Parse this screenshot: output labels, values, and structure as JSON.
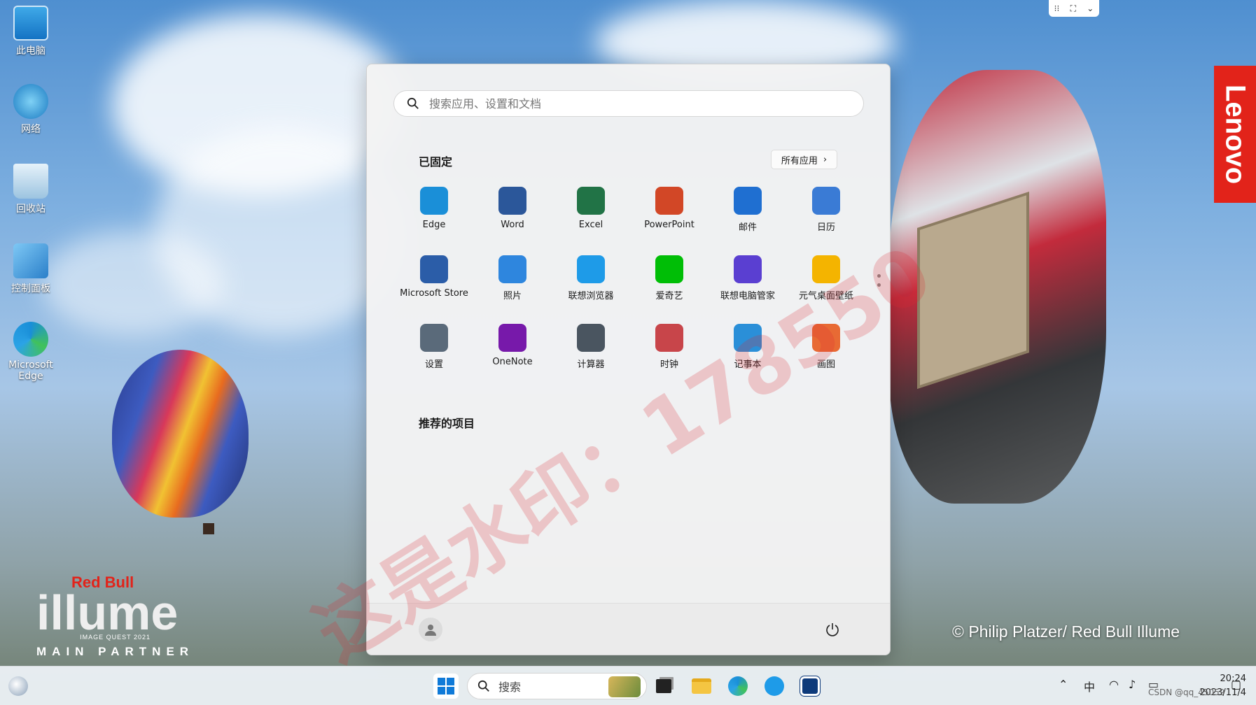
{
  "desktop": {
    "icons": [
      {
        "label": "此电脑",
        "icon": "computer-icon"
      },
      {
        "label": "网络",
        "icon": "network-icon"
      },
      {
        "label": "回收站",
        "icon": "recycle-bin-icon"
      },
      {
        "label": "控制面板",
        "icon": "control-panel-icon"
      },
      {
        "label": "Microsoft Edge",
        "icon": "edge-icon"
      }
    ],
    "lenovo_label": "Lenovo",
    "illume": {
      "brand": "Red Bull",
      "word": "illume",
      "sub": "IMAGE QUEST 2021",
      "partner": "MAIN PARTNER"
    },
    "credit": "© Philip Platzer/ Red Bull Illume",
    "watermark": "这是水印：178550"
  },
  "start_menu": {
    "search_placeholder": "搜索应用、设置和文档",
    "pinned_title": "已固定",
    "all_apps_label": "所有应用",
    "apps": [
      {
        "label": "Edge",
        "icon": "edge-icon",
        "color": "#1a8fd8"
      },
      {
        "label": "Word",
        "icon": "word-icon",
        "color": "#2b579a"
      },
      {
        "label": "Excel",
        "icon": "excel-icon",
        "color": "#217346"
      },
      {
        "label": "PowerPoint",
        "icon": "powerpoint-icon",
        "color": "#d24726"
      },
      {
        "label": "邮件",
        "icon": "mail-icon",
        "color": "#1f6fd1"
      },
      {
        "label": "日历",
        "icon": "calendar-icon",
        "color": "#3a7bd5"
      },
      {
        "label": "Microsoft Store",
        "icon": "store-icon",
        "color": "#2b5da8"
      },
      {
        "label": "照片",
        "icon": "photos-icon",
        "color": "#2e86de"
      },
      {
        "label": "联想浏览器",
        "icon": "lenovo-browser-icon",
        "color": "#1e9be8"
      },
      {
        "label": "爱奇艺",
        "icon": "iqiyi-icon",
        "color": "#00be06"
      },
      {
        "label": "联想电脑管家",
        "icon": "lenovo-manager-icon",
        "color": "#5a3fd1"
      },
      {
        "label": "元气桌面壁纸",
        "icon": "wallpaper-icon",
        "color": "#f4b400"
      },
      {
        "label": "设置",
        "icon": "settings-icon",
        "color": "#5a6a7a"
      },
      {
        "label": "OneNote",
        "icon": "onenote-icon",
        "color": "#7719aa"
      },
      {
        "label": "计算器",
        "icon": "calculator-icon",
        "color": "#4a5560"
      },
      {
        "label": "时钟",
        "icon": "clock-icon",
        "color": "#c8454a"
      },
      {
        "label": "记事本",
        "icon": "notepad-icon",
        "color": "#2a8fd8"
      },
      {
        "label": "画图",
        "icon": "paint-icon",
        "color": "#e86a34"
      }
    ],
    "recommended_title": "推荐的项目"
  },
  "taskbar": {
    "search_label": "搜索",
    "ime": "中",
    "time": "20:24",
    "date": "2023/11/4",
    "csdn": "CSDN @qq_45059"
  }
}
